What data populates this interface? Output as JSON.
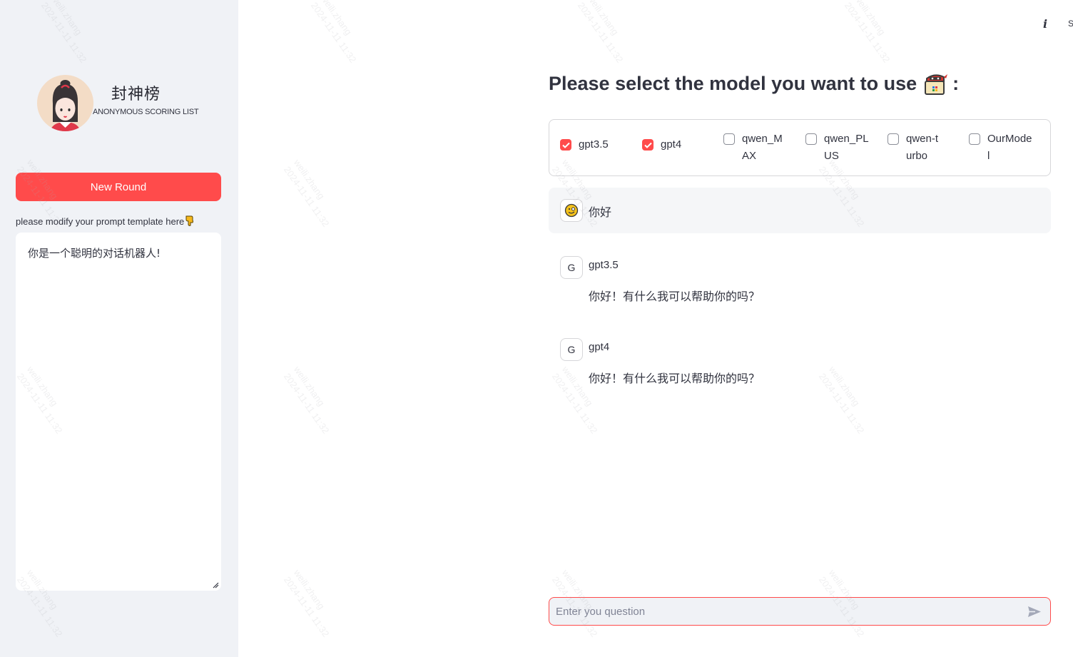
{
  "sidebar": {
    "brand_title": "封神榜",
    "brand_subtitle": "ANONYMOUS SCORING LIST",
    "new_round_label": "New Round",
    "prompt_label": "please modify your prompt template here",
    "prompt_value": "你是一个聪明的对话机器人!"
  },
  "header": {
    "info_icon": "info-icon",
    "cut_text": "S"
  },
  "main": {
    "heading": "Please select the model you want to use",
    "heading_suffix": ":",
    "models": [
      {
        "label": "gpt3.5",
        "checked": true
      },
      {
        "label": "gpt4",
        "checked": true
      },
      {
        "label": "qwen_MAX",
        "checked": false
      },
      {
        "label": "qwen_PLUS",
        "checked": false
      },
      {
        "label": "qwen-turbo",
        "checked": false
      },
      {
        "label": "OurModel",
        "checked": false
      }
    ],
    "messages": {
      "user_text": "你好",
      "responses": [
        {
          "avatar": "G",
          "name": "gpt3.5",
          "text": "你好！有什么我可以帮助你的吗？"
        },
        {
          "avatar": "G",
          "name": "gpt4",
          "text": "你好！有什么我可以帮助你的吗？"
        }
      ]
    },
    "chat_input": {
      "placeholder": "Enter you question",
      "value": ""
    }
  },
  "watermark": {
    "line1": "weili.zhang",
    "line2": "2024-11-11 11:32"
  },
  "colors": {
    "accent": "#ff4b4b",
    "sidebar_bg": "#f0f2f6",
    "text": "#31333f"
  }
}
